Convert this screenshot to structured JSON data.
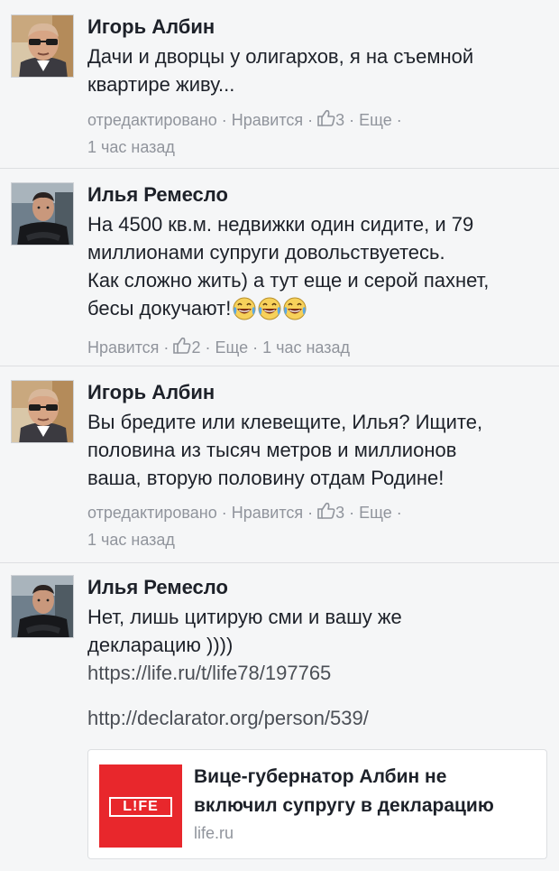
{
  "comments": [
    {
      "author": "Игорь Албин",
      "lines": [
        "Дачи и дворцы у олигархов, я на съемной",
        "квартире живу..."
      ],
      "meta_line1": "отредактировано · Нравится · ",
      "likes": "3",
      "meta_after": " · Еще ·",
      "meta_line2": "1 час назад"
    },
    {
      "author": "Илья Ремесло",
      "lines": [
        "На 4500 кв.м. недвижки один сидите, и 79",
        "миллионами супруги довольствуетесь.",
        "Как сложно жить) а тут еще и серой пахнет,",
        "бесы докучают!"
      ],
      "meta_line1": "Нравится · ",
      "likes": "2",
      "meta_after": " · Еще · 1 час назад"
    },
    {
      "author": "Игорь Албин",
      "lines": [
        "Вы бредите или клевещите, Илья? Ищите,",
        "половина из тысяч метров и миллионов",
        "ваша, вторую половину отдам Родине!"
      ],
      "meta_line1": "отредактировано · Нравится · ",
      "likes": "3",
      "meta_after": " · Еще ·",
      "meta_line2": "1 час назад"
    },
    {
      "author": "Илья Ремесло",
      "lines": [
        "Нет, лишь цитирую сми и вашу же",
        "декларацию ))))"
      ],
      "link1": "https://life.ru/t/life78/197765",
      "link2": "http://declarator.org/person/539/"
    }
  ],
  "preview": {
    "logo_text": "L!FE",
    "title_line1": "Вице-губернатор Албин не",
    "title_line2": "включил супругу в декларацию",
    "domain": "life.ru"
  },
  "icons": [
    "thumbs-up-icon",
    "laughing-emoji-icon"
  ],
  "colors": {
    "background": "#f5f6f7",
    "meta": "#90949c",
    "life_red": "#e8272c"
  }
}
